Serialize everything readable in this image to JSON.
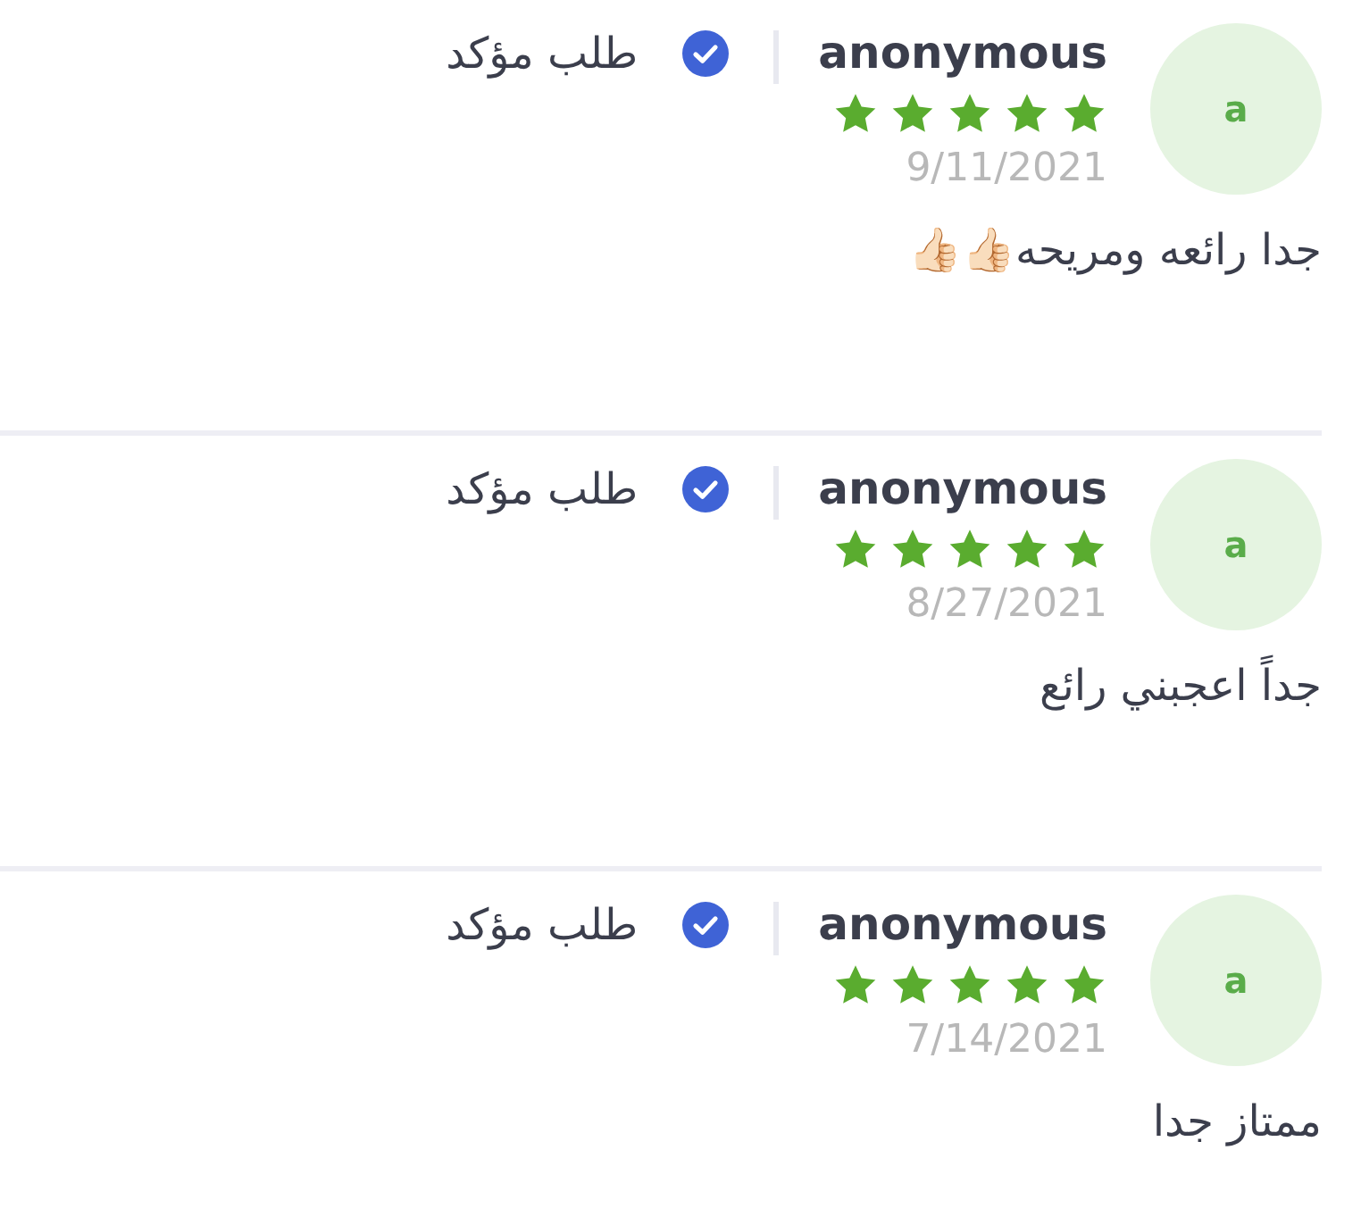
{
  "reviews": [
    {
      "avatar": "a",
      "name": "anonymous",
      "stars": 5,
      "date": "9/11/2021",
      "verified": true,
      "verified_label": "طلب مؤكد",
      "text": "جدا رائعه ومريحه👍🏻👍🏻"
    },
    {
      "avatar": "a",
      "name": "anonymous",
      "stars": 5,
      "date": "8/27/2021",
      "verified": true,
      "verified_label": "طلب مؤكد",
      "text": "جداً اعجبني رائع"
    },
    {
      "avatar": "a",
      "name": "anonymous",
      "stars": 5,
      "date": "7/14/2021",
      "verified": true,
      "verified_label": "طلب مؤكد",
      "text": "ممتاز جدا"
    }
  ]
}
